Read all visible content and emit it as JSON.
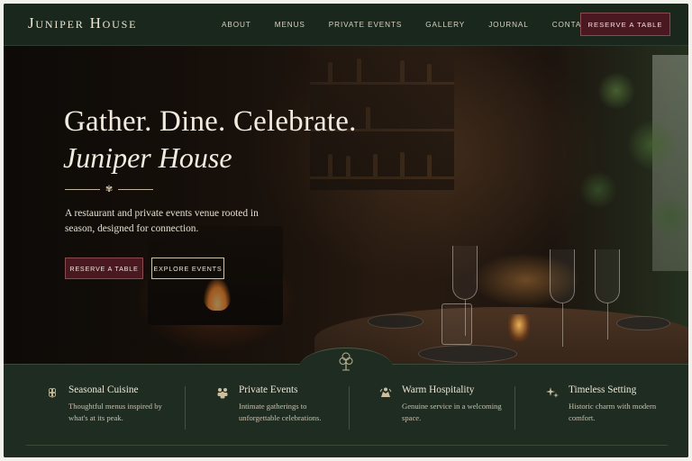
{
  "brand": {
    "name": "Juniper House"
  },
  "nav": {
    "items": [
      "ABOUT",
      "MENUS",
      "PRIVATE EVENTS",
      "GALLERY",
      "JOURNAL",
      "CONTACT"
    ],
    "cta_label": "RESERVE A TABLE"
  },
  "hero": {
    "title_line1": "Gather. Dine. Celebrate.",
    "title_line2": "Juniper House",
    "subtitle": "A restaurant and private events venue rooted in season, designed for connection.",
    "primary_button": "RESERVE A TABLE",
    "secondary_button": "EXPLORE EVENTS"
  },
  "features": [
    {
      "title": "Seasonal Cuisine",
      "description": "Thoughtful menus inspired by what's at its peak.",
      "icon": "wheat-icon"
    },
    {
      "title": "Private Events",
      "description": "Intimate gatherings to unforgettable celebrations.",
      "icon": "people-icon"
    },
    {
      "title": "Warm Hospitality",
      "description": "Genuine service in a welcoming space.",
      "icon": "hospitality-icon"
    },
    {
      "title": "Timeless Setting",
      "description": "Historic charm with modern comfort.",
      "icon": "sparkle-icon"
    }
  ],
  "colors": {
    "nav_bg": "#1a271d",
    "accent_burgundy": "#4a1820",
    "text_cream": "#f2ece0",
    "features_bg": "#1e2c22"
  }
}
